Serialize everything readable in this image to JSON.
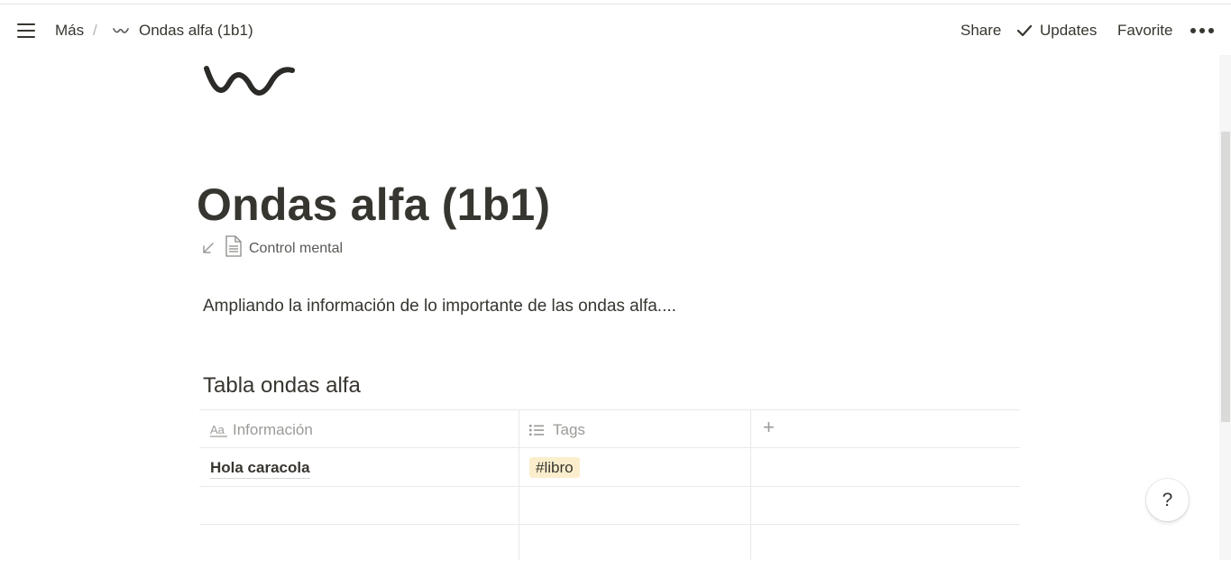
{
  "topbar": {
    "breadcrumb_parent": "Más",
    "breadcrumb_separator": "/",
    "breadcrumb_current": "Ondas alfa (1b1)",
    "share_label": "Share",
    "updates_label": "Updates",
    "favorite_label": "Favorite"
  },
  "page": {
    "title": "Ondas alfa (1b1)",
    "backlink_label": "Control mental",
    "paragraph": "Ampliando la información de lo importante de las ondas alfa....",
    "table_heading": "Tabla ondas alfa"
  },
  "table": {
    "columns": [
      {
        "label": "Información",
        "icon": "text-property-icon"
      },
      {
        "label": "Tags",
        "icon": "list-property-icon"
      }
    ],
    "add_column": "+",
    "rows": [
      {
        "informacion": "Hola caracola",
        "tags": [
          "#libro"
        ]
      },
      {
        "informacion": "",
        "tags": []
      },
      {
        "informacion": "",
        "tags": []
      }
    ]
  },
  "help_label": "?",
  "colors": {
    "text": "#37352f",
    "muted": "#9b9a97",
    "tag_bg": "#fbeecc",
    "border": "#e9e9e7"
  }
}
